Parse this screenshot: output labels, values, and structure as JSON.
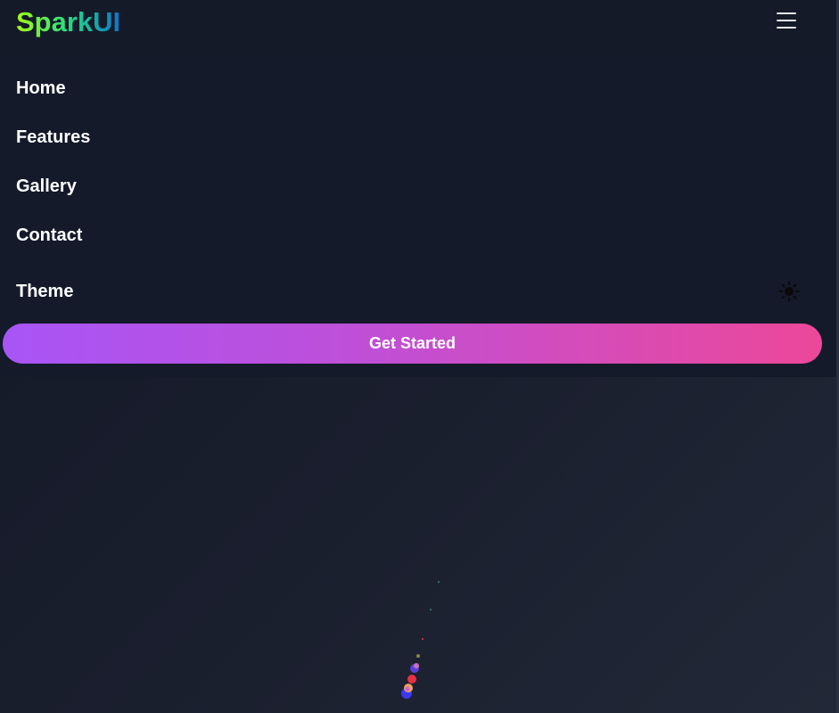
{
  "header": {
    "logo_text": "SparkUI",
    "menu_icon": "hamburger-menu-icon"
  },
  "nav": {
    "items": [
      {
        "label": "Home"
      },
      {
        "label": "Features"
      },
      {
        "label": "Gallery"
      },
      {
        "label": "Contact"
      }
    ],
    "theme_label": "Theme",
    "theme_icon": "sun-icon"
  },
  "cta": {
    "label": "Get Started"
  },
  "colors": {
    "background": "#1a1f2e",
    "menu_panel": "#141a2a",
    "cta_gradient_start": "#a855f7",
    "cta_gradient_end": "#ec4899",
    "logo_gradient_start": "#a3ff12",
    "logo_gradient_end": "#1270c8"
  }
}
